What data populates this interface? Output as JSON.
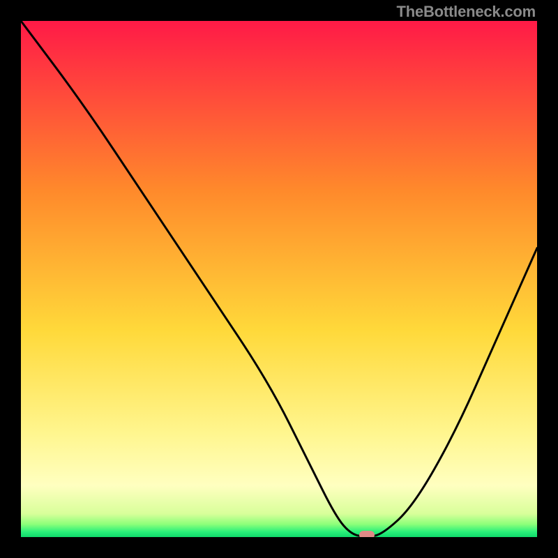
{
  "watermark": "TheBottleneck.com",
  "chart_data": {
    "type": "line",
    "title": "",
    "xlabel": "",
    "ylabel": "",
    "xlim": [
      0,
      100
    ],
    "ylim": [
      0,
      100
    ],
    "grid": false,
    "legend": false,
    "series": [
      {
        "name": "bottleneck-curve",
        "x": [
          0,
          12,
          24,
          36,
          48,
          56,
          61,
          64,
          67,
          70,
          76,
          84,
          92,
          100
        ],
        "y": [
          100,
          84,
          66,
          48,
          30,
          14,
          4,
          0.5,
          0,
          0.5,
          6,
          20,
          38,
          56
        ]
      }
    ],
    "marker": {
      "x": 67,
      "y": 0,
      "color": "#e08a87"
    },
    "gradient_stops": [
      {
        "offset": 0.0,
        "color": "#ff1a47"
      },
      {
        "offset": 0.33,
        "color": "#ff8a2b"
      },
      {
        "offset": 0.6,
        "color": "#ffd93a"
      },
      {
        "offset": 0.8,
        "color": "#fff68f"
      },
      {
        "offset": 0.9,
        "color": "#ffffc0"
      },
      {
        "offset": 0.955,
        "color": "#d8ff9a"
      },
      {
        "offset": 0.975,
        "color": "#8dff7a"
      },
      {
        "offset": 0.99,
        "color": "#29f07a"
      },
      {
        "offset": 1.0,
        "color": "#0fd96b"
      }
    ]
  }
}
